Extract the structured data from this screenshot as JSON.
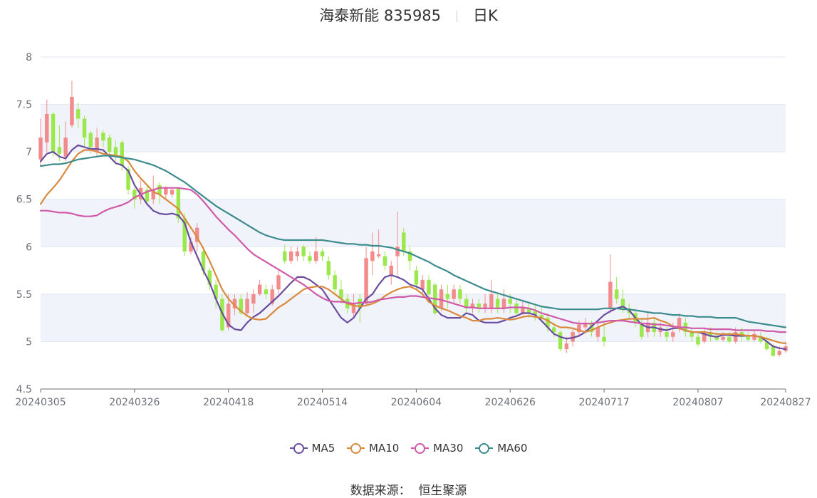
{
  "title": {
    "name": "海泰新能 835985",
    "period": "日K"
  },
  "source": {
    "label": "数据来源：",
    "value": "恒生聚源"
  },
  "colors": {
    "up": "#f28c8c",
    "down": "#9be84d",
    "ma5": "#6a4d9e",
    "ma10": "#d98a3d",
    "ma30": "#d05aa8",
    "ma60": "#3c8c8e",
    "band": "#f1f3fa",
    "grid": "#e0e6f1"
  },
  "chart_data": {
    "type": "candlestick",
    "ylim": [
      4.5,
      8
    ],
    "y_ticks": [
      "4.5",
      "5",
      "5.5",
      "6",
      "6.5",
      "7",
      "7.5",
      "8"
    ],
    "x_tick_labels": [
      {
        "label": "20240305",
        "index": 0
      },
      {
        "label": "20240326",
        "index": 15
      },
      {
        "label": "20240418",
        "index": 30
      },
      {
        "label": "20240514",
        "index": 45
      },
      {
        "label": "20240604",
        "index": 60
      },
      {
        "label": "20240626",
        "index": 75
      },
      {
        "label": "20240717",
        "index": 90
      },
      {
        "label": "20240807",
        "index": 105
      },
      {
        "label": "20240827",
        "index": 119
      }
    ],
    "candles": [
      [
        6.92,
        7.15,
        6.85,
        7.35
      ],
      [
        7.1,
        7.4,
        7.0,
        7.55
      ],
      [
        7.4,
        7.0,
        6.95,
        7.42
      ],
      [
        7.05,
        6.98,
        6.9,
        7.28
      ],
      [
        6.95,
        7.15,
        6.9,
        7.32
      ],
      [
        7.28,
        7.58,
        7.25,
        7.75
      ],
      [
        7.45,
        7.35,
        7.25,
        7.52
      ],
      [
        7.35,
        7.15,
        7.05,
        7.38
      ],
      [
        7.2,
        7.05,
        6.98,
        7.22
      ],
      [
        7.0,
        7.15,
        6.95,
        7.25
      ],
      [
        7.2,
        7.12,
        7.05,
        7.23
      ],
      [
        7.15,
        7.0,
        6.95,
        7.18
      ],
      [
        7.05,
        6.95,
        6.9,
        7.12
      ],
      [
        7.1,
        6.85,
        6.8,
        7.12
      ],
      [
        6.82,
        6.6,
        6.55,
        6.85
      ],
      [
        6.6,
        6.5,
        6.4,
        6.62
      ],
      [
        6.5,
        6.62,
        6.45,
        6.7
      ],
      [
        6.6,
        6.48,
        6.45,
        6.65
      ],
      [
        6.5,
        6.6,
        6.45,
        6.75
      ],
      [
        6.65,
        6.55,
        6.45,
        6.68
      ],
      [
        6.55,
        6.62,
        6.5,
        6.64
      ],
      [
        6.55,
        6.6,
        6.52,
        6.62
      ],
      [
        6.62,
        6.3,
        6.25,
        6.62
      ],
      [
        6.3,
        5.95,
        5.9,
        6.35
      ],
      [
        5.95,
        6.05,
        5.92,
        6.1
      ],
      [
        6.05,
        6.2,
        5.95,
        6.25
      ],
      [
        5.95,
        5.75,
        5.7,
        6.0
      ],
      [
        5.75,
        5.6,
        5.55,
        5.78
      ],
      [
        5.6,
        5.45,
        5.35,
        5.65
      ],
      [
        5.45,
        5.12,
        5.1,
        5.5
      ],
      [
        5.15,
        5.4,
        5.12,
        5.5
      ],
      [
        5.35,
        5.45,
        5.28,
        5.5
      ],
      [
        5.45,
        5.3,
        5.28,
        5.5
      ],
      [
        5.3,
        5.45,
        5.28,
        5.52
      ],
      [
        5.4,
        5.5,
        5.3,
        5.55
      ],
      [
        5.5,
        5.6,
        5.48,
        5.65
      ],
      [
        5.55,
        5.5,
        5.45,
        5.6
      ],
      [
        5.4,
        5.55,
        5.38,
        5.6
      ],
      [
        5.55,
        5.7,
        5.5,
        5.75
      ],
      [
        5.95,
        5.85,
        5.82,
        6.02
      ],
      [
        5.85,
        5.95,
        5.82,
        6.0
      ],
      [
        5.9,
        5.95,
        5.85,
        6.0
      ],
      [
        6.0,
        5.9,
        5.85,
        6.02
      ],
      [
        5.9,
        5.85,
        5.82,
        5.95
      ],
      [
        5.85,
        5.95,
        5.82,
        6.1
      ],
      [
        5.95,
        5.9,
        5.85,
        5.98
      ],
      [
        5.85,
        5.7,
        5.65,
        5.9
      ],
      [
        5.7,
        5.55,
        5.5,
        5.75
      ],
      [
        5.55,
        5.45,
        5.4,
        5.65
      ],
      [
        5.45,
        5.35,
        5.3,
        5.5
      ],
      [
        5.3,
        5.4,
        5.25,
        5.5
      ],
      [
        5.45,
        5.35,
        5.2,
        5.5
      ],
      [
        5.4,
        5.88,
        5.38,
        6.0
      ],
      [
        5.85,
        5.95,
        5.7,
        6.15
      ],
      [
        5.9,
        5.92,
        5.88,
        6.18
      ],
      [
        5.9,
        5.8,
        5.75,
        5.95
      ],
      [
        5.7,
        5.8,
        5.6,
        5.85
      ],
      [
        5.9,
        6.0,
        5.7,
        6.37
      ],
      [
        6.15,
        5.95,
        5.9,
        6.2
      ],
      [
        5.95,
        5.85,
        5.75,
        6.0
      ],
      [
        5.75,
        5.6,
        5.55,
        5.8
      ],
      [
        5.55,
        5.65,
        5.5,
        5.7
      ],
      [
        5.65,
        5.5,
        5.45,
        5.7
      ],
      [
        5.6,
        5.3,
        5.28,
        5.62
      ],
      [
        5.35,
        5.55,
        5.32,
        5.6
      ],
      [
        5.5,
        5.45,
        5.35,
        5.6
      ],
      [
        5.45,
        5.55,
        5.4,
        5.6
      ],
      [
        5.55,
        5.45,
        5.4,
        5.6
      ],
      [
        5.45,
        5.35,
        5.3,
        5.5
      ],
      [
        5.35,
        5.4,
        5.3,
        5.45
      ],
      [
        5.4,
        5.35,
        5.3,
        5.45
      ],
      [
        5.35,
        5.4,
        5.3,
        5.5
      ],
      [
        5.35,
        5.5,
        5.3,
        5.65
      ],
      [
        5.45,
        5.35,
        5.3,
        5.5
      ],
      [
        5.35,
        5.45,
        5.3,
        5.55
      ],
      [
        5.45,
        5.4,
        5.3,
        5.5
      ],
      [
        5.4,
        5.3,
        5.25,
        5.45
      ],
      [
        5.3,
        5.35,
        5.28,
        5.42
      ],
      [
        5.35,
        5.3,
        5.25,
        5.4
      ],
      [
        5.32,
        5.28,
        5.22,
        5.38
      ],
      [
        5.28,
        5.25,
        5.2,
        5.38
      ],
      [
        5.25,
        5.15,
        5.1,
        5.3
      ],
      [
        5.15,
        5.1,
        5.05,
        5.2
      ],
      [
        5.1,
        4.92,
        4.9,
        5.12
      ],
      [
        4.92,
        4.98,
        4.88,
        5.05
      ],
      [
        5.0,
        5.1,
        4.95,
        5.15
      ],
      [
        5.1,
        5.18,
        5.05,
        5.22
      ],
      [
        5.15,
        5.2,
        5.1,
        5.25
      ],
      [
        5.2,
        5.1,
        5.05,
        5.22
      ],
      [
        5.05,
        5.15,
        5.0,
        5.2
      ],
      [
        5.05,
        5.0,
        4.95,
        5.2
      ],
      [
        5.35,
        5.63,
        5.3,
        5.92
      ],
      [
        5.55,
        5.45,
        5.4,
        5.68
      ],
      [
        5.45,
        5.35,
        5.3,
        5.55
      ],
      [
        5.35,
        5.3,
        5.25,
        5.4
      ],
      [
        5.3,
        5.2,
        5.15,
        5.35
      ],
      [
        5.2,
        5.05,
        5.02,
        5.25
      ],
      [
        5.1,
        5.2,
        5.05,
        5.3
      ],
      [
        5.2,
        5.1,
        5.05,
        5.25
      ],
      [
        5.1,
        5.15,
        5.05,
        5.2
      ],
      [
        5.1,
        5.05,
        5.0,
        5.15
      ],
      [
        5.05,
        5.1,
        5.0,
        5.2
      ],
      [
        5.15,
        5.25,
        5.1,
        5.3
      ],
      [
        5.2,
        5.1,
        5.05,
        5.25
      ],
      [
        5.1,
        5.05,
        5.0,
        5.15
      ],
      [
        5.05,
        4.97,
        4.95,
        5.1
      ],
      [
        5.0,
        5.1,
        4.98,
        5.15
      ],
      [
        5.1,
        5.05,
        5.0,
        5.15
      ],
      [
        5.05,
        5.02,
        5.0,
        5.1
      ],
      [
        5.02,
        5.05,
        5.0,
        5.1
      ],
      [
        5.05,
        5.0,
        4.98,
        5.1
      ],
      [
        5.0,
        5.1,
        4.98,
        5.15
      ],
      [
        5.1,
        5.05,
        5.0,
        5.15
      ],
      [
        5.05,
        5.02,
        5.0,
        5.1
      ],
      [
        5.02,
        5.08,
        5.0,
        5.12
      ],
      [
        5.06,
        5.0,
        4.98,
        5.1
      ],
      [
        5.0,
        4.92,
        4.9,
        5.05
      ],
      [
        4.95,
        4.85,
        4.84,
        4.98
      ],
      [
        4.86,
        4.9,
        4.84,
        4.95
      ],
      [
        4.9,
        4.95,
        4.88,
        5.0
      ]
    ],
    "series": [
      {
        "name": "MA5",
        "values": [
          6.9,
          6.98,
          7.0,
          6.95,
          6.93,
          7.02,
          7.07,
          7.05,
          7.03,
          7.03,
          7.02,
          6.95,
          6.88,
          6.86,
          6.8,
          6.65,
          6.55,
          6.45,
          6.38,
          6.35,
          6.34,
          6.35,
          6.33,
          6.25,
          6.05,
          5.9,
          5.75,
          5.62,
          5.45,
          5.3,
          5.18,
          5.13,
          5.12,
          5.2,
          5.26,
          5.3,
          5.36,
          5.42,
          5.48,
          5.55,
          5.62,
          5.68,
          5.68,
          5.65,
          5.6,
          5.55,
          5.45,
          5.35,
          5.25,
          5.2,
          5.25,
          5.35,
          5.45,
          5.5,
          5.6,
          5.68,
          5.7,
          5.68,
          5.65,
          5.6,
          5.58,
          5.55,
          5.45,
          5.35,
          5.28,
          5.25,
          5.25,
          5.25,
          5.3,
          5.28,
          5.22,
          5.2,
          5.2,
          5.2,
          5.22,
          5.25,
          5.27,
          5.3,
          5.3,
          5.28,
          5.22,
          5.15,
          5.08,
          5.05,
          5.03,
          5.04,
          5.06,
          5.1,
          5.16,
          5.22,
          5.28,
          5.32,
          5.35,
          5.37,
          5.33,
          5.25,
          5.18,
          5.15,
          5.15,
          5.13,
          5.12,
          5.14,
          5.14,
          5.12,
          5.1,
          5.1,
          5.08,
          5.06,
          5.05,
          5.07,
          5.07,
          5.06,
          5.06,
          5.06,
          5.06,
          5.05,
          5.0,
          4.95,
          4.93,
          4.92
        ]
      },
      {
        "name": "MA10",
        "values": [
          6.45,
          6.55,
          6.62,
          6.7,
          6.8,
          6.9,
          6.98,
          7.02,
          7.02,
          7.0,
          6.98,
          6.97,
          6.96,
          6.95,
          6.9,
          6.8,
          6.72,
          6.65,
          6.58,
          6.55,
          6.5,
          6.45,
          6.4,
          6.3,
          6.2,
          6.1,
          5.98,
          5.85,
          5.7,
          5.55,
          5.45,
          5.38,
          5.32,
          5.27,
          5.24,
          5.23,
          5.24,
          5.3,
          5.36,
          5.4,
          5.45,
          5.5,
          5.55,
          5.57,
          5.58,
          5.58,
          5.55,
          5.5,
          5.45,
          5.4,
          5.38,
          5.37,
          5.38,
          5.4,
          5.43,
          5.48,
          5.52,
          5.55,
          5.57,
          5.58,
          5.55,
          5.5,
          5.42,
          5.38,
          5.35,
          5.33,
          5.3,
          5.27,
          5.25,
          5.22,
          5.22,
          5.24,
          5.24,
          5.25,
          5.24,
          5.23,
          5.24,
          5.26,
          5.27,
          5.26,
          5.25,
          5.22,
          5.18,
          5.15,
          5.15,
          5.14,
          5.12,
          5.1,
          5.12,
          5.15,
          5.18,
          5.2,
          5.22,
          5.23,
          5.24,
          5.24,
          5.24,
          5.24,
          5.25,
          5.22,
          5.2,
          5.16,
          5.14,
          5.12,
          5.1,
          5.1,
          5.1,
          5.09,
          5.08,
          5.08,
          5.08,
          5.08,
          5.07,
          5.06,
          5.06,
          5.05,
          5.03,
          5.01,
          4.99,
          4.98
        ]
      },
      {
        "name": "MA30",
        "values": [
          6.38,
          6.38,
          6.37,
          6.36,
          6.36,
          6.35,
          6.33,
          6.32,
          6.32,
          6.33,
          6.37,
          6.4,
          6.42,
          6.44,
          6.47,
          6.52,
          6.55,
          6.58,
          6.6,
          6.62,
          6.62,
          6.62,
          6.62,
          6.61,
          6.6,
          6.55,
          6.48,
          6.4,
          6.32,
          6.25,
          6.18,
          6.12,
          6.05,
          5.98,
          5.92,
          5.88,
          5.84,
          5.8,
          5.76,
          5.72,
          5.68,
          5.64,
          5.6,
          5.55,
          5.5,
          5.46,
          5.43,
          5.42,
          5.42,
          5.41,
          5.4,
          5.41,
          5.41,
          5.42,
          5.44,
          5.45,
          5.46,
          5.47,
          5.47,
          5.48,
          5.48,
          5.47,
          5.46,
          5.45,
          5.44,
          5.42,
          5.4,
          5.38,
          5.36,
          5.36,
          5.35,
          5.35,
          5.35,
          5.35,
          5.35,
          5.36,
          5.36,
          5.36,
          5.35,
          5.33,
          5.3,
          5.28,
          5.26,
          5.24,
          5.22,
          5.2,
          5.19,
          5.19,
          5.19,
          5.2,
          5.21,
          5.22,
          5.22,
          5.22,
          5.21,
          5.2,
          5.19,
          5.19,
          5.18,
          5.18,
          5.17,
          5.16,
          5.15,
          5.15,
          5.14,
          5.14,
          5.14,
          5.13,
          5.13,
          5.13,
          5.13,
          5.12,
          5.12,
          5.12,
          5.12,
          5.12,
          5.11,
          5.11,
          5.1,
          5.1
        ]
      },
      {
        "name": "MA60",
        "values": [
          6.85,
          6.86,
          6.87,
          6.87,
          6.88,
          6.9,
          6.92,
          6.93,
          6.94,
          6.95,
          6.96,
          6.96,
          6.95,
          6.94,
          6.93,
          6.92,
          6.9,
          6.88,
          6.86,
          6.83,
          6.8,
          6.76,
          6.72,
          6.68,
          6.63,
          6.58,
          6.53,
          6.48,
          6.43,
          6.39,
          6.35,
          6.31,
          6.27,
          6.23,
          6.19,
          6.15,
          6.12,
          6.1,
          6.08,
          6.07,
          6.07,
          6.07,
          6.07,
          6.07,
          6.07,
          6.07,
          6.06,
          6.05,
          6.04,
          6.03,
          6.03,
          6.02,
          6.02,
          6.01,
          6.01,
          6.0,
          5.99,
          5.97,
          5.95,
          5.93,
          5.9,
          5.87,
          5.84,
          5.8,
          5.77,
          5.74,
          5.7,
          5.67,
          5.64,
          5.61,
          5.58,
          5.55,
          5.53,
          5.51,
          5.49,
          5.47,
          5.45,
          5.43,
          5.41,
          5.39,
          5.37,
          5.36,
          5.35,
          5.34,
          5.34,
          5.34,
          5.34,
          5.34,
          5.34,
          5.34,
          5.35,
          5.35,
          5.35,
          5.34,
          5.34,
          5.33,
          5.32,
          5.31,
          5.3,
          5.3,
          5.29,
          5.28,
          5.28,
          5.27,
          5.27,
          5.26,
          5.26,
          5.26,
          5.25,
          5.25,
          5.25,
          5.25,
          5.23,
          5.21,
          5.2,
          5.19,
          5.18,
          5.17,
          5.16,
          5.15
        ]
      }
    ]
  }
}
